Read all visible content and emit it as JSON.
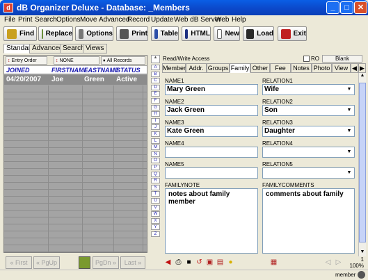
{
  "window": {
    "title": "dB Organizer Deluxe - Database: _Members",
    "min": "_",
    "max": "□",
    "close": "✕"
  },
  "menu": [
    "File",
    "Print",
    "Search",
    "Options",
    "Move",
    "Advanced",
    "Record",
    "Update",
    "Web dB Server",
    "Web",
    "Help"
  ],
  "toolbar": [
    "Find",
    "Replace",
    "Options",
    "Print",
    "Table",
    "HTML",
    "New",
    "Load",
    "Exit"
  ],
  "mode_tabs": [
    "Standard",
    "Advanced",
    "Search",
    "Views"
  ],
  "list": {
    "header_buttons": [
      "Entry Order",
      "NONE",
      "All Records"
    ],
    "columns": [
      "JOINED",
      "FIRSTNAME",
      "LASTNAME",
      "STATUS"
    ],
    "rows": [
      [
        "04/20/2007",
        "Joe",
        "Green",
        "Active"
      ]
    ],
    "nav": [
      "First",
      "PgUp",
      "PgDn",
      "Last"
    ]
  },
  "alphabet": [
    "A",
    "B",
    "C",
    "D",
    "E",
    "F",
    "G",
    "H",
    "I",
    "J",
    "K",
    "L",
    "M",
    "N",
    "O",
    "P",
    "Q",
    "R",
    "S",
    "T",
    "U",
    "V",
    "W",
    "X",
    "Y",
    "Z"
  ],
  "record": {
    "access": "Read/Write Access",
    "ro_label": "RO",
    "blank_label": "Blank",
    "tabs": [
      "Member",
      "Addr.",
      "Groups",
      "Family",
      "Other",
      "Fee",
      "Notes",
      "Photo",
      "View"
    ],
    "active_tab": "Family",
    "fields": [
      {
        "name_label": "NAME1",
        "name": "Mary Green",
        "rel_label": "RELATION1",
        "rel": "Wife"
      },
      {
        "name_label": "NAME2",
        "name": "Jack Green",
        "rel_label": "RELATION2",
        "rel": "Son"
      },
      {
        "name_label": "NAME3",
        "name": "Kate Green",
        "rel_label": "RELATION3",
        "rel": "Daughter"
      },
      {
        "name_label": "NAME4",
        "name": "",
        "rel_label": "RELATION4",
        "rel": ""
      },
      {
        "name_label": "NAME5",
        "name": "",
        "rel_label": "RELATION5",
        "rel": ""
      }
    ],
    "note_label": "FAMILYNOTE",
    "note": "notes about family member",
    "comments_label": "FAMILYCOMMENTS",
    "comments": "comments about family"
  },
  "status": {
    "count": "1",
    "zoom": "100%",
    "user": "member"
  }
}
